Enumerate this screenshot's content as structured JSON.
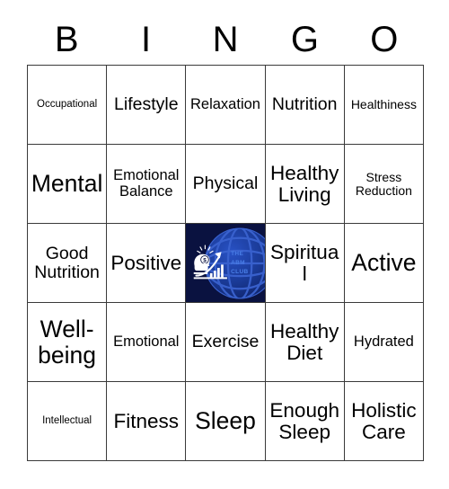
{
  "card": {
    "type": "bingo-card",
    "columns": 5,
    "rows": 5,
    "header_letters": [
      "B",
      "I",
      "N",
      "G",
      "O"
    ],
    "background_color": "#ffffff",
    "border_color": "#3a3a3a",
    "text_color": "#000000"
  },
  "rows": [
    [
      {
        "label": "Occupational",
        "size": "fs-xs"
      },
      {
        "label": "Lifestyle",
        "size": "fs-l"
      },
      {
        "label": "Relaxation",
        "size": "fs-m"
      },
      {
        "label": "Nutrition",
        "size": "fs-l"
      },
      {
        "label": "Healthiness",
        "size": "fs-s"
      }
    ],
    [
      {
        "label": "Mental",
        "size": "fs-xxl"
      },
      {
        "label": "Emotional Balance",
        "size": "fs-m"
      },
      {
        "label": "Physical",
        "size": "fs-l"
      },
      {
        "label": "Healthy Living",
        "size": "fs-xl"
      },
      {
        "label": "Stress Reduction",
        "size": "fs-s"
      }
    ],
    [
      {
        "label": "Good Nutrition",
        "size": "fs-l"
      },
      {
        "label": "Positive",
        "size": "fs-xl"
      },
      {
        "label": "",
        "size": "fs-m",
        "is_free_space": true
      },
      {
        "label": "Spiritual",
        "size": "fs-xl"
      },
      {
        "label": "Active",
        "size": "fs-xxl"
      }
    ],
    [
      {
        "label": "Well-being",
        "size": "fs-xxl"
      },
      {
        "label": "Emotional",
        "size": "fs-m"
      },
      {
        "label": "Exercise",
        "size": "fs-l"
      },
      {
        "label": "Healthy Diet",
        "size": "fs-xl"
      },
      {
        "label": "Hydrated",
        "size": "fs-m"
      }
    ],
    [
      {
        "label": "Intellectual",
        "size": "fs-xs"
      },
      {
        "label": "Fitness",
        "size": "fs-xl"
      },
      {
        "label": "Sleep",
        "size": "fs-xxl"
      },
      {
        "label": "Enough Sleep",
        "size": "fs-xl"
      },
      {
        "label": "Holistic Care",
        "size": "fs-xl"
      }
    ]
  ],
  "free_space_logo": {
    "wordmark_lines": [
      "THE",
      "ABM",
      "CLUB"
    ],
    "wordmark_color": "#4a7fe8",
    "background_color": "#0a1240",
    "globe_color": "#1b3fa0",
    "globe_line_color": "#2f56bf",
    "mark_color": "#ffffff",
    "icons": [
      "head-silhouette-icon",
      "lightbulb-icon",
      "dollar-sign-icon",
      "growth-arrow-icon",
      "bar-chart-icon",
      "globe-icon"
    ]
  }
}
